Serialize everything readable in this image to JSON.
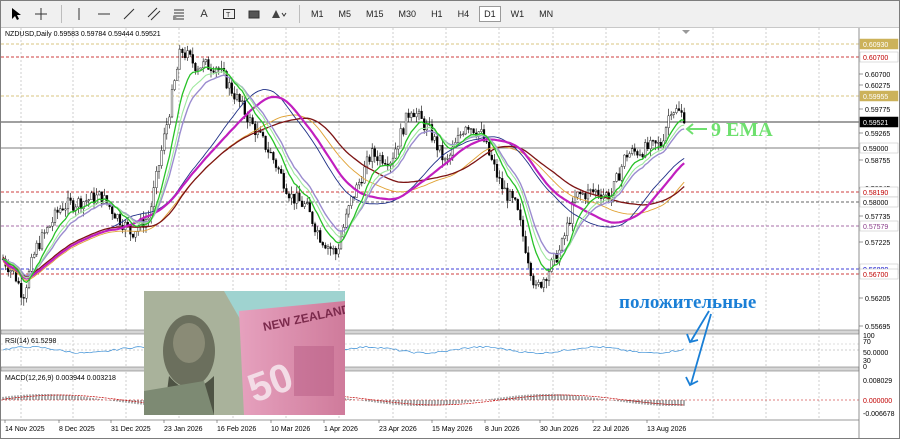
{
  "toolbar": {
    "tools": [
      {
        "name": "cursor-icon"
      },
      {
        "name": "crosshair-icon"
      },
      {
        "name": "vertical-line-icon"
      },
      {
        "name": "horizontal-line-icon"
      },
      {
        "name": "trend-line-icon"
      },
      {
        "name": "equidistant-channel-icon"
      },
      {
        "name": "fibonacci-icon"
      },
      {
        "name": "text-icon"
      },
      {
        "name": "text-label-icon"
      },
      {
        "name": "rectangle-icon"
      },
      {
        "name": "shapes-icon"
      }
    ],
    "text_tool_glyph": "A",
    "timeframes": [
      "M1",
      "M5",
      "M15",
      "M30",
      "H1",
      "H4",
      "D1",
      "W1",
      "MN"
    ],
    "active_timeframe": "D1"
  },
  "chart": {
    "title": "NZDUSD,Daily  0.59583 0.59784 0.59444 0.59521",
    "price_axis": {
      "prices": [
        "0.60700",
        "0.60275",
        "0.59775",
        "0.59265",
        "0.58755",
        "0.58245",
        "0.57735",
        "0.57225",
        "0.56715",
        "0.56205",
        "0.55695"
      ],
      "tags": [
        {
          "text": "0.60930",
          "bg": "#ccb25a",
          "fg": "#ffffff"
        },
        {
          "text": "0.60700",
          "bg": "#ffffff",
          "fg": "#c00000"
        },
        {
          "text": "0.59955",
          "bg": "#ccb25a",
          "fg": "#ffffff"
        },
        {
          "text": "0.59521",
          "bg": "#000000",
          "fg": "#ffffff"
        },
        {
          "text": "0.59000",
          "bg": "#ffffff",
          "fg": "#000000"
        },
        {
          "text": "0.58190",
          "bg": "#ffffff",
          "fg": "#c00000"
        },
        {
          "text": "0.58000",
          "bg": "#ffffff",
          "fg": "#000000"
        },
        {
          "text": "0.57579",
          "bg": "#ffffff",
          "fg": "#8b3c8b"
        },
        {
          "text": "0.56800",
          "bg": "#ffffff",
          "fg": "#0000cc"
        },
        {
          "text": "0.56700",
          "bg": "#ffffff",
          "fg": "#c00000"
        }
      ]
    },
    "dates": [
      "14 Nov 2025",
      "8 Dec 2025",
      "31 Dec 2025",
      "23 Jan 2026",
      "16 Feb 2026",
      "10 Mar 2026",
      "1 Apr 2026",
      "23 Apr 2026",
      "15 May 2026",
      "8 Jun 2026",
      "30 Jun 2026",
      "22 Jul 2026",
      "13 Aug 2026"
    ]
  },
  "annotations": {
    "ema": "9 EMA",
    "positive": "положительные"
  },
  "rsi": {
    "label": "RSI(14) 61.5298",
    "levels": [
      "100",
      "70",
      "50.0000",
      "30",
      "0"
    ]
  },
  "macd": {
    "label": "MACD(12,26,9) 0.003944 0.003218",
    "levels": [
      "0.008029",
      "0.000000",
      "-0.006678"
    ]
  },
  "colors": {
    "ema9": "#27c227",
    "ema_light": "#9ee89e",
    "lavender": "#9b8ccf",
    "magenta": "#c11fbf",
    "maroon": "#7d1414",
    "navy": "#1f2f86",
    "orange": "#e0a234",
    "annotation_blue": "#1a7fd6",
    "annotation_green": "#6ee06e"
  }
}
